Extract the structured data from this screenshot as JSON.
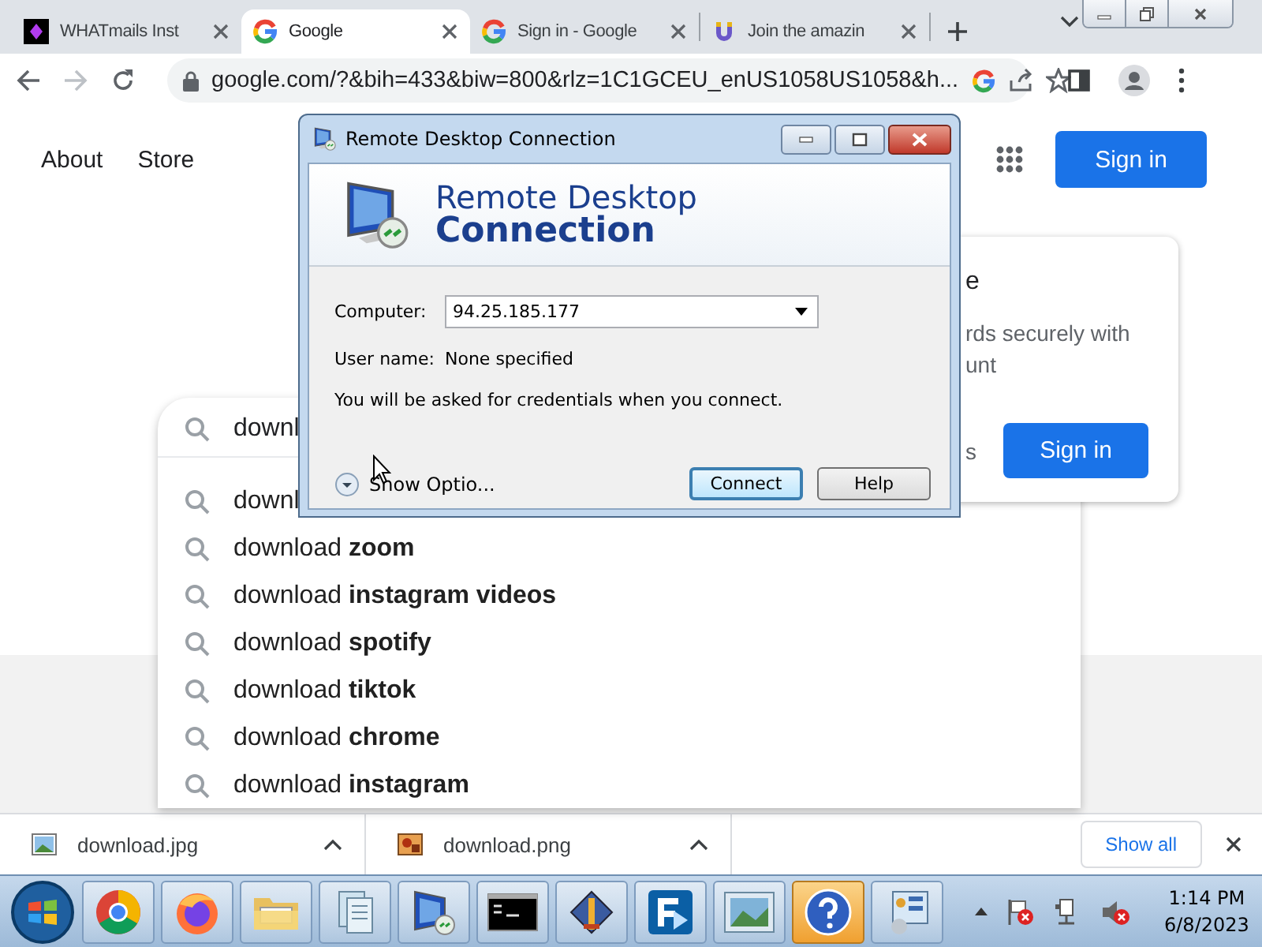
{
  "browser": {
    "tabs": [
      {
        "title": "WHATmails Inst",
        "kind": "app",
        "selected": false
      },
      {
        "title": "Google",
        "kind": "google",
        "selected": true
      },
      {
        "title": "Sign in - Google",
        "kind": "google",
        "selected": false
      },
      {
        "title": "Join the amazin",
        "kind": "magnet",
        "selected": false
      }
    ],
    "address": "google.com/?&bih=433&biw=800&rlz=1C1GCEU_enUS1058US1058&h..."
  },
  "google": {
    "links": [
      "About",
      "Store"
    ],
    "sign_in": "Sign in",
    "search": {
      "value": "downl",
      "suggestions": [
        "downl",
        "download **zoom**",
        "download **instagram videos**",
        "download **spotify**",
        "download **tiktok**",
        "download **chrome**",
        "download **instagram**"
      ]
    },
    "card": {
      "heading": "e",
      "lines": [
        "rds securely with",
        "unt"
      ],
      "link": "s",
      "button": "Sign in"
    }
  },
  "rdp_dialog": {
    "title": "Remote Desktop Connection",
    "banner": [
      "Remote Desktop",
      "Connection"
    ],
    "fields": [
      {
        "label": "Computer:",
        "value": "94.25.185.177",
        "kind": "combo"
      },
      {
        "label": "User name:",
        "value": "None specified",
        "kind": "static"
      }
    ],
    "note": "You will be asked for credentials when you connect.",
    "options": "Show Optio...",
    "buttons": [
      {
        "label": "Connect",
        "default": true
      },
      {
        "label": "Help",
        "default": false
      }
    ]
  },
  "downloads": {
    "files": [
      {
        "name": "download.jpg",
        "kind": "landscape"
      },
      {
        "name": "download.png",
        "kind": "picture"
      }
    ],
    "show_all": "Show all"
  },
  "taskbar": {
    "apps": [
      {
        "kind": "chrome",
        "highlighted": false
      },
      {
        "kind": "firefox",
        "highlighted": false
      },
      {
        "kind": "folder",
        "highlighted": false
      },
      {
        "kind": "document",
        "highlighted": false
      },
      {
        "kind": "monitor",
        "highlighted": false
      },
      {
        "kind": "terminal",
        "highlighted": false
      },
      {
        "kind": "tool",
        "highlighted": false
      },
      {
        "kind": "transfer",
        "highlighted": false
      },
      {
        "kind": "photo",
        "highlighted": false
      },
      {
        "kind": "help",
        "highlighted": true
      },
      {
        "kind": "panel",
        "highlighted": false
      }
    ],
    "time": "1:14 PM",
    "date": "6/8/2023"
  }
}
